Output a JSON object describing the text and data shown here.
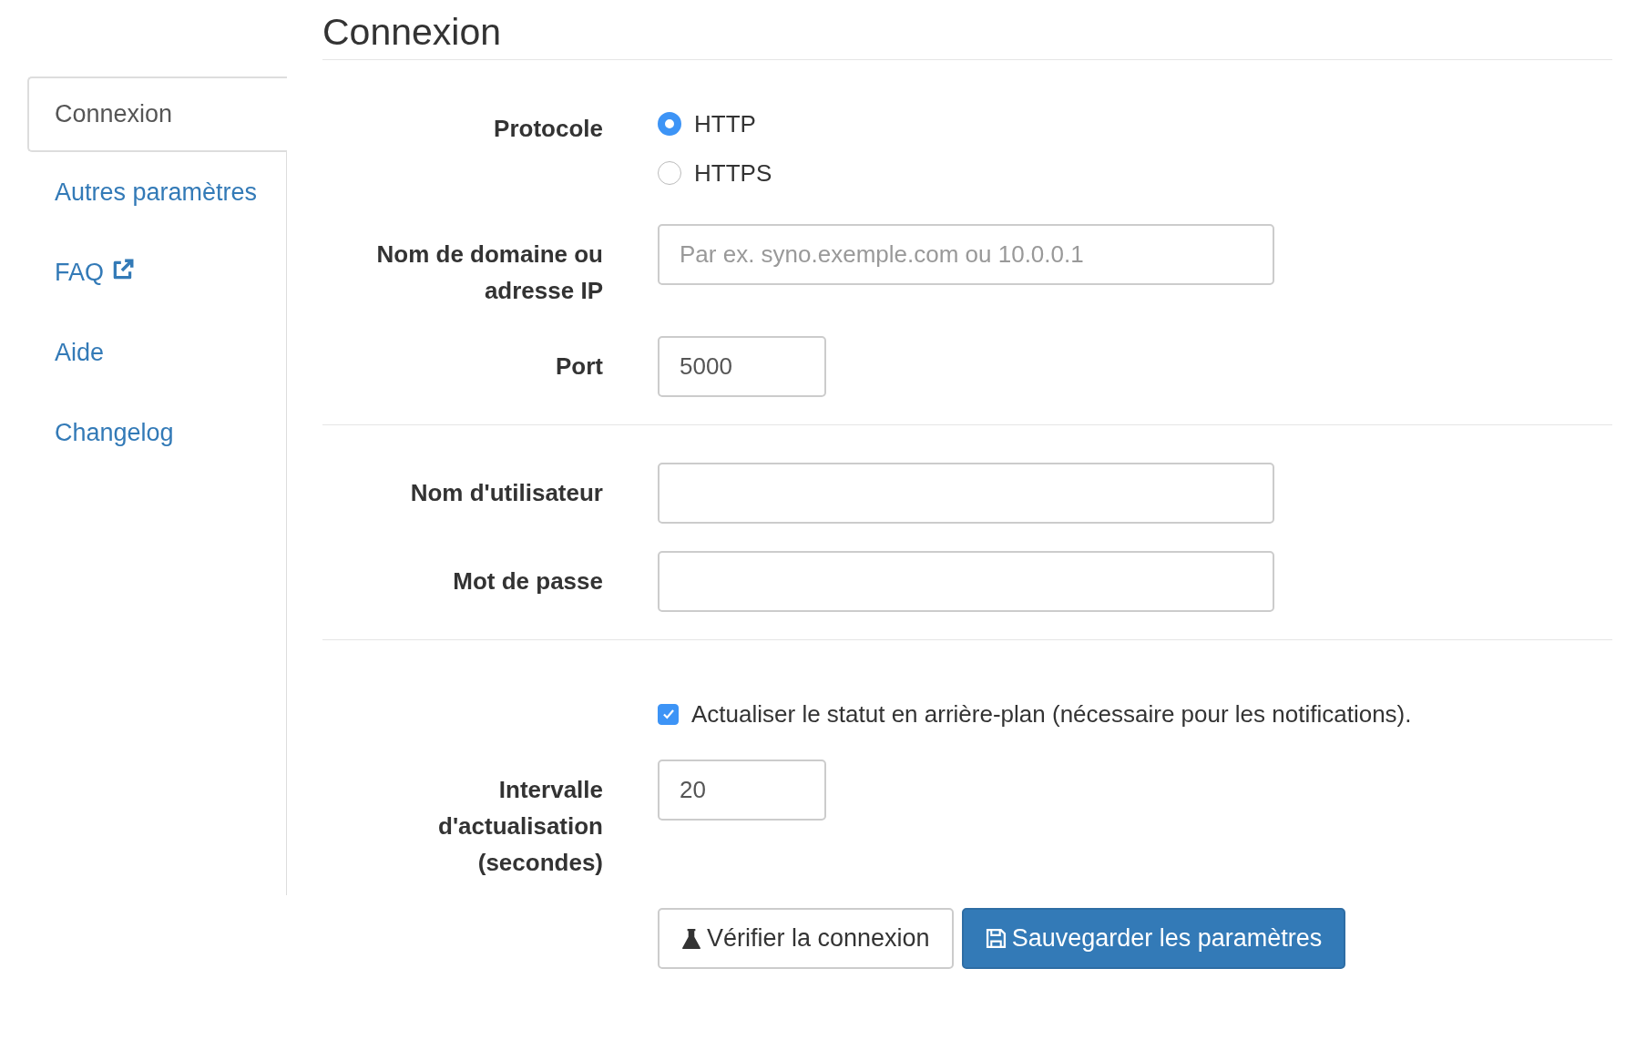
{
  "sidebar": {
    "items": [
      {
        "label": "Connexion",
        "selected": true,
        "external": false
      },
      {
        "label": "Autres paramètres",
        "selected": false,
        "external": false
      },
      {
        "label": "FAQ",
        "selected": false,
        "external": true
      },
      {
        "label": "Aide",
        "selected": false,
        "external": false
      },
      {
        "label": "Changelog",
        "selected": false,
        "external": false
      }
    ]
  },
  "title": "Connexion",
  "sections": [
    {
      "rows": [
        {
          "kind": "radio",
          "label": "Protocole",
          "options": [
            {
              "label": "HTTP",
              "selected": true
            },
            {
              "label": "HTTPS",
              "selected": false
            }
          ]
        },
        {
          "kind": "wide_input",
          "label": "Nom de domaine ou adresse IP",
          "placeholder": "Par ex. syno.exemple.com ou 10.0.0.1"
        },
        {
          "kind": "short_input",
          "label": "Port",
          "value": "5000"
        }
      ]
    },
    {
      "rows": [
        {
          "kind": "wide_input",
          "label": "Nom d'utilisateur"
        },
        {
          "kind": "password",
          "label": "Mot de passe"
        }
      ]
    },
    {
      "rows": [
        {
          "kind": "checkbox",
          "text": "Actualiser le statut en arrière-plan (nécessaire pour les notifications).",
          "checked": true
        },
        {
          "kind": "short_input",
          "label": "Intervalle d'actualisation (secondes)",
          "value": "20"
        }
      ]
    }
  ],
  "buttons": [
    {
      "kind": "default",
      "label": "Vérifier la connexion"
    },
    {
      "kind": "primary",
      "label": "Sauvegarder les paramètres"
    }
  ]
}
